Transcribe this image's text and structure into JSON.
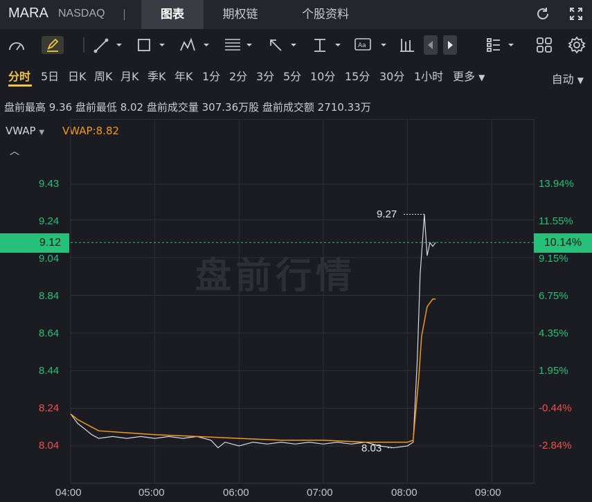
{
  "header": {
    "ticker": "MARA",
    "exchange": "NASDAQ",
    "tabs": [
      "图表",
      "期权链",
      "个股资料"
    ],
    "active_tab": 0
  },
  "toolbar": {
    "icons": [
      "indicator-icon",
      "draw-pen-icon",
      "line-tool-icon",
      "rect-tool-icon",
      "pattern-tool-icon",
      "fib-tool-icon",
      "arrow-tool-icon",
      "text-baseline-tool-icon",
      "text-label-tool-icon",
      "bar-icon",
      "prev-arrow-icon",
      "next-arrow-icon",
      "layout-list-icon",
      "grid-icon",
      "settings-icon"
    ]
  },
  "periods": {
    "items": [
      "分时",
      "5日",
      "日K",
      "周K",
      "月K",
      "季K",
      "年K",
      "1分",
      "2分",
      "3分",
      "5分",
      "10分",
      "15分",
      "30分",
      "1小时",
      "更多"
    ],
    "active": "分时",
    "auto_label": "自动"
  },
  "stats": {
    "text": "盘前最高 9.36 盘前最低 8.02 盘前成交量 307.36万股 盘前成交额 2710.33万"
  },
  "indicator": {
    "name": "VWAP",
    "value_label": "VWAP:8.82"
  },
  "watermark": "盘前行情",
  "colors": {
    "up": "#26c07a",
    "down": "#f0514b",
    "vwap": "#f39a1d",
    "price": "#d8dadf",
    "active": "#f3c545"
  },
  "chart_data": {
    "type": "line",
    "y_price_ticks": [
      "9.43",
      "9.24",
      "9.04",
      "8.84",
      "8.64",
      "8.44",
      "8.24",
      "8.04"
    ],
    "y_pct_ticks": [
      "13.94%",
      "11.55%",
      "9.15%",
      "6.75%",
      "4.35%",
      "1.95%",
      "-0.44%",
      "-2.84%"
    ],
    "x_ticks": [
      "04:00",
      "05:00",
      "06:00",
      "07:00",
      "08:00",
      "09:00"
    ],
    "current_price": "9.12",
    "current_pct": "10.14%",
    "high_marker": "9.27",
    "low_marker": "8.03",
    "ylim": [
      7.95,
      9.55
    ],
    "series": [
      {
        "name": "Price",
        "points": [
          [
            "04:00",
            8.21
          ],
          [
            "04:05",
            8.16
          ],
          [
            "04:10",
            8.13
          ],
          [
            "04:15",
            8.1
          ],
          [
            "04:20",
            8.08
          ],
          [
            "04:30",
            8.09
          ],
          [
            "04:40",
            8.08
          ],
          [
            "04:50",
            8.09
          ],
          [
            "05:00",
            8.08
          ],
          [
            "05:10",
            8.09
          ],
          [
            "05:20",
            8.08
          ],
          [
            "05:30",
            8.09
          ],
          [
            "05:40",
            8.07
          ],
          [
            "05:45",
            8.03
          ],
          [
            "05:50",
            8.06
          ],
          [
            "06:00",
            8.04
          ],
          [
            "06:10",
            8.06
          ],
          [
            "06:20",
            8.05
          ],
          [
            "06:30",
            8.06
          ],
          [
            "06:40",
            8.05
          ],
          [
            "06:50",
            8.06
          ],
          [
            "07:00",
            8.05
          ],
          [
            "07:10",
            8.06
          ],
          [
            "07:20",
            8.05
          ],
          [
            "07:30",
            8.06
          ],
          [
            "07:40",
            8.04
          ],
          [
            "07:50",
            8.03
          ],
          [
            "08:00",
            8.04
          ],
          [
            "08:04",
            8.06
          ],
          [
            "08:07",
            8.5
          ],
          [
            "08:09",
            8.95
          ],
          [
            "08:12",
            9.27
          ],
          [
            "08:14",
            9.05
          ],
          [
            "08:16",
            9.12
          ],
          [
            "08:18",
            9.1
          ],
          [
            "08:20",
            9.12
          ]
        ]
      },
      {
        "name": "VWAP",
        "points": [
          [
            "04:00",
            8.21
          ],
          [
            "04:05",
            8.18
          ],
          [
            "04:20",
            8.12
          ],
          [
            "04:40",
            8.11
          ],
          [
            "05:00",
            8.1
          ],
          [
            "05:30",
            8.09
          ],
          [
            "06:00",
            8.08
          ],
          [
            "06:30",
            8.07
          ],
          [
            "07:00",
            8.07
          ],
          [
            "07:30",
            8.06
          ],
          [
            "08:00",
            8.06
          ],
          [
            "08:04",
            8.07
          ],
          [
            "08:08",
            8.4
          ],
          [
            "08:10",
            8.62
          ],
          [
            "08:14",
            8.78
          ],
          [
            "08:18",
            8.82
          ],
          [
            "08:20",
            8.82
          ]
        ]
      }
    ],
    "grid": true
  }
}
